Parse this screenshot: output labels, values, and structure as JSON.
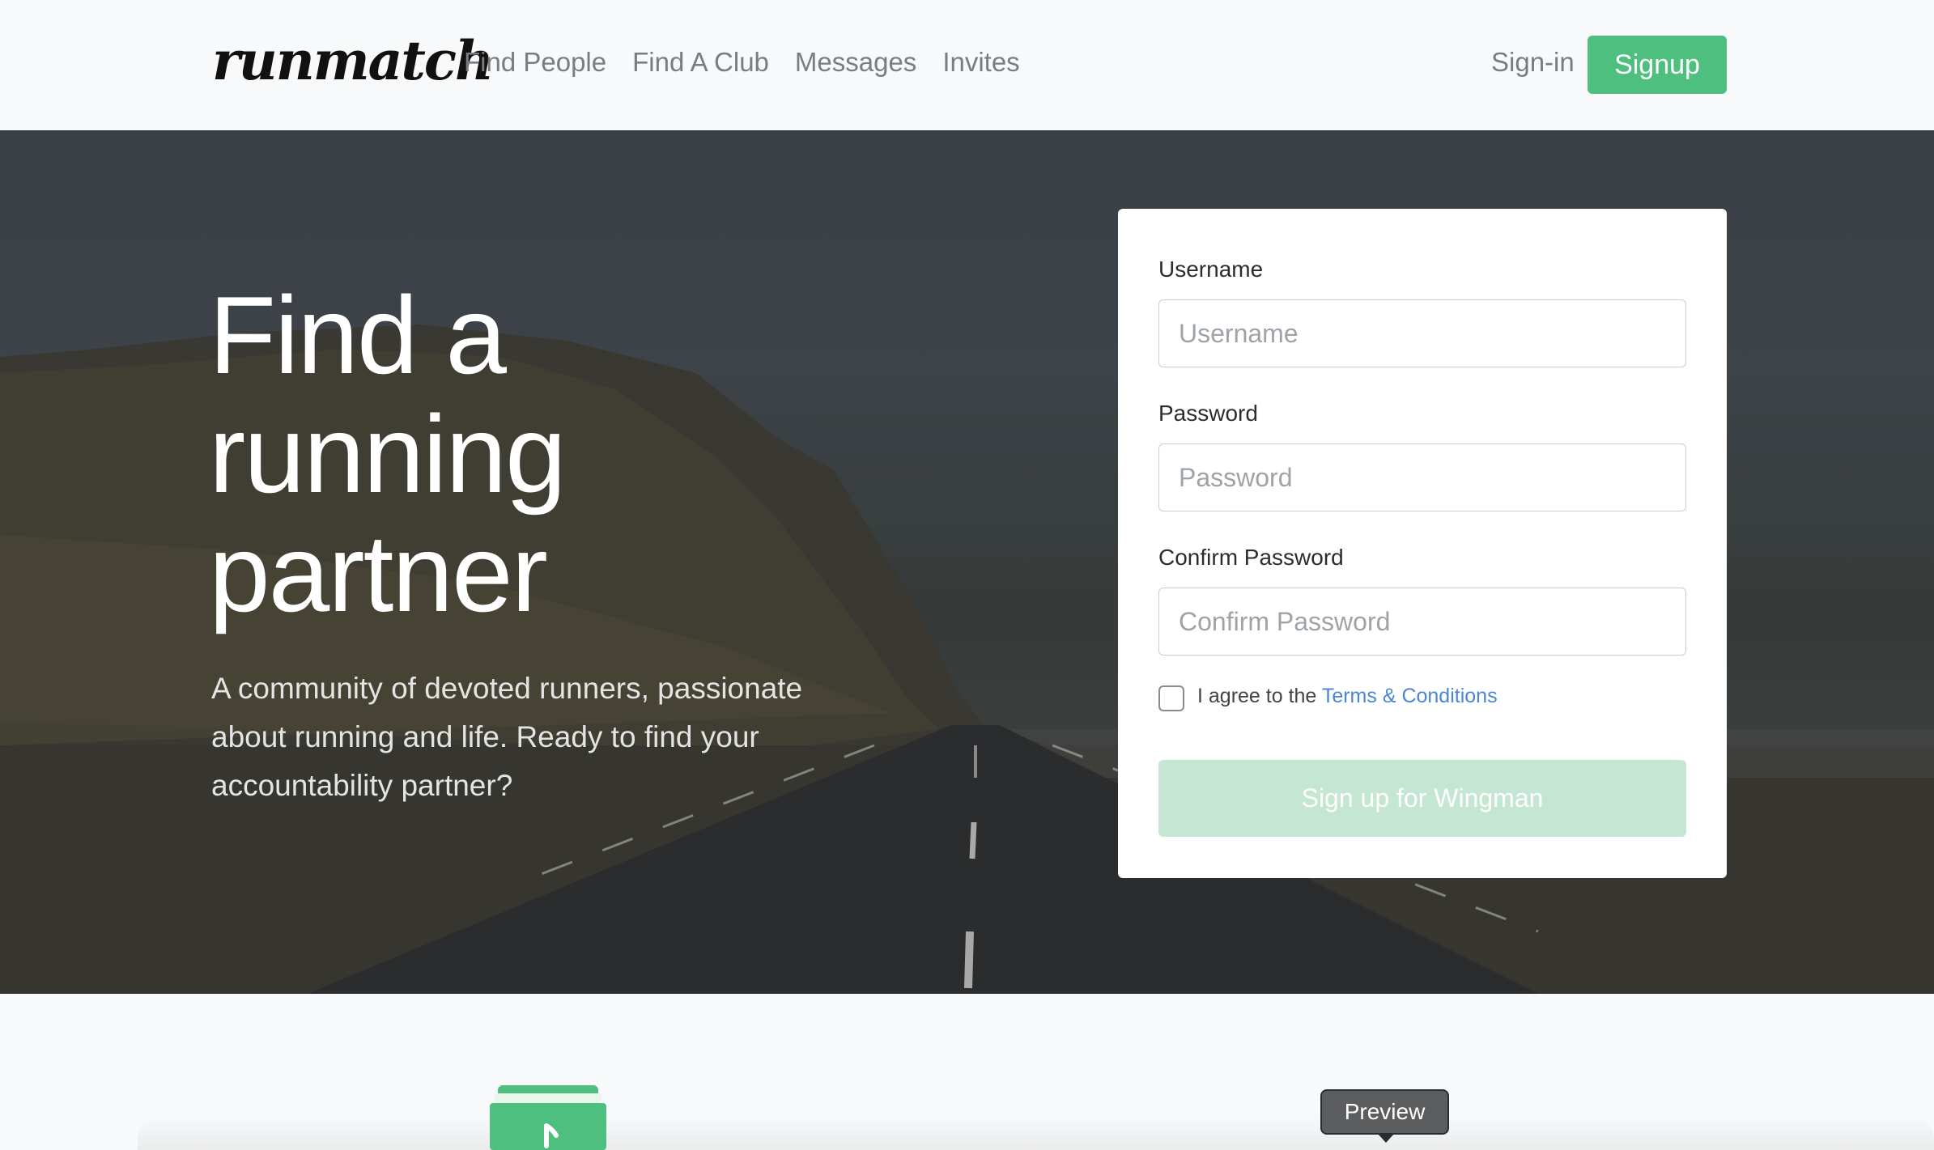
{
  "navbar": {
    "brand": "runmatch",
    "links": [
      "Find People",
      "Find A Club",
      "Messages",
      "Invites"
    ],
    "signin_label": "Sign-in",
    "signup_label": "Signup"
  },
  "hero": {
    "headline_lines": [
      "Find a",
      "running",
      "partner"
    ],
    "subtext": "A community of devoted runners, passionate about running and life. Ready to find your accountability partner?"
  },
  "form": {
    "username_label": "Username",
    "username_placeholder": "Username",
    "password_label": "Password",
    "password_placeholder": "Password",
    "confirm_label": "Confirm Password",
    "confirm_placeholder": "Confirm Password",
    "agree_text": "I agree to the ",
    "terms_link": "Terms & Conditions",
    "submit_label": "Sign up for Wingman"
  },
  "bottom": {
    "tooltip": "Preview",
    "icons": [
      "folder-music-icon"
    ]
  },
  "colors": {
    "accent": "#4fbf80",
    "accent_disabled": "#c4e6d3",
    "link": "#4a86d8"
  }
}
